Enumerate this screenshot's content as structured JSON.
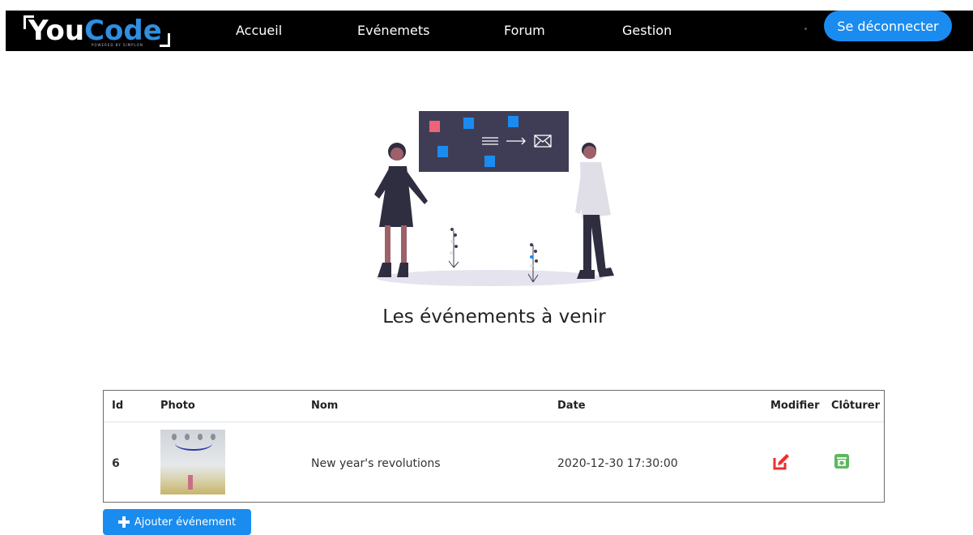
{
  "brand": {
    "name_part1": "You",
    "name_part2": "Code",
    "tagline": "POWERED BY SIMPLON"
  },
  "nav": {
    "links": [
      "Accueil",
      "Evénemets",
      "Forum",
      "Gestion"
    ],
    "logout_label": "Se déconnecter"
  },
  "hero": {
    "illustration": "presentation-illustration",
    "title": "Les événements à venir"
  },
  "table": {
    "headers": [
      "Id",
      "Photo",
      "Nom",
      "Date",
      "Modifier",
      "Clôturer"
    ],
    "rows": [
      {
        "id": "6",
        "photo": "event-photo",
        "name": "New year's revolutions",
        "date": "2020-12-30 17:30:00",
        "edit_icon": "edit-icon",
        "close_icon": "archive-icon"
      }
    ]
  },
  "actions": {
    "add_label": "Ajouter événement"
  },
  "colors": {
    "navbar_bg": "#000000",
    "accent": "#1a8cf0",
    "edit": "#ef2d2d",
    "archive": "#5cb85c"
  }
}
